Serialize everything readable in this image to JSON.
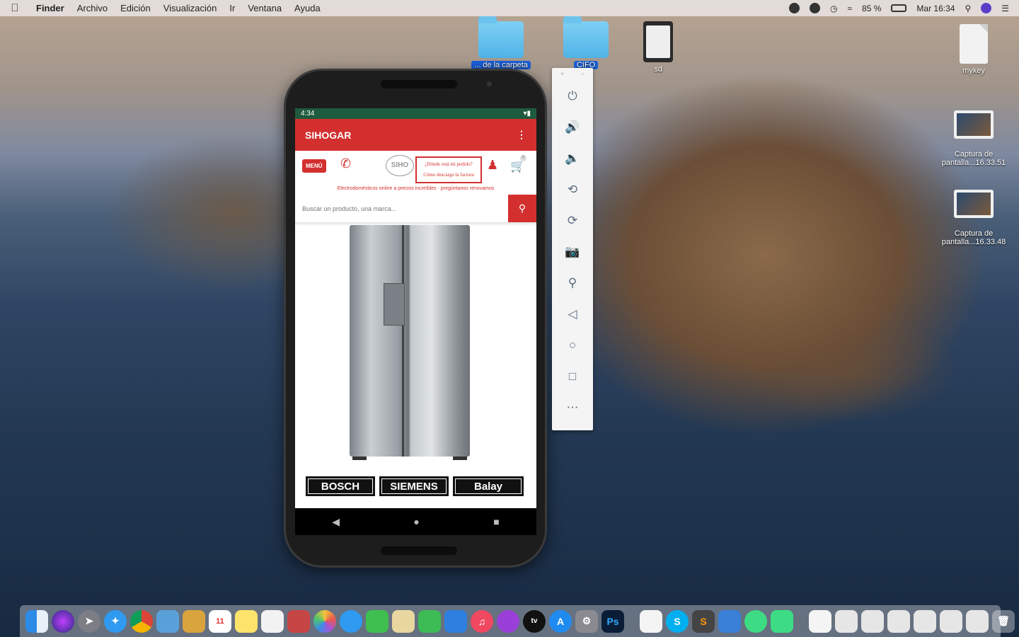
{
  "menubar": {
    "apple_icon": "apple-icon",
    "items": [
      "Finder",
      "Archivo",
      "Edición",
      "Visualización",
      "Ir",
      "Ventana",
      "Ayuda"
    ],
    "battery": "85 %",
    "clock": "Mar 16:34"
  },
  "desktop": {
    "icons": [
      {
        "label": "... de la carpeta",
        "type": "folder",
        "selected": true
      },
      {
        "label": "CIFO",
        "type": "folder",
        "selected": true
      },
      {
        "label": "sd",
        "type": "sdcard",
        "selected": false
      },
      {
        "label": "mykey",
        "type": "document",
        "selected": false
      },
      {
        "label": "Captura de pantalla...16.33.51",
        "type": "screenshot",
        "selected": false
      },
      {
        "label": "Captura de pantalla...16.33.48",
        "type": "screenshot",
        "selected": false
      }
    ]
  },
  "phone": {
    "status_time": "4:34",
    "app_title": "SIHOGAR",
    "menu_label": "MENÚ",
    "logo_text": "SIHO",
    "promo_line1": "¿Dónde está mi pedido?",
    "promo_line2": "Cómo descargo la factura",
    "cart_count": "0",
    "tagline": "Electrodomésticos online a precios increíbles - pregúntanos renovamos",
    "search_placeholder": "Buscar un producto, una marca...",
    "brands": [
      "BOSCH",
      "SIEMENS",
      "Balay"
    ]
  },
  "emulator_toolbar": {
    "buttons": [
      "power-icon",
      "volume-up-icon",
      "volume-down-icon",
      "rotate-left-icon",
      "rotate-right-icon",
      "camera-icon",
      "zoom-icon",
      "back-icon",
      "home-icon",
      "overview-icon",
      "more-icon"
    ]
  },
  "dock": {
    "apps": [
      "Finder",
      "Siri",
      "Launchpad",
      "Safari",
      "Chrome",
      "Preview",
      "Notes",
      "Calendar",
      "Stickies",
      "Reminders",
      "Photo Booth",
      "Photos",
      "Messages",
      "FaceTime",
      "Maps",
      "Numbers",
      "Keynote",
      "Music",
      "Podcasts",
      "TV",
      "App Store",
      "System Preferences",
      "Photoshop",
      "TextEdit",
      "Skype",
      "Sublime Text",
      "Xcode",
      "Android Studio",
      "Android Emulator"
    ],
    "calendar_day": "11"
  },
  "colors": {
    "brand_red": "#d32f2f",
    "status_green": "#1e5a3d",
    "folder_blue": "#4fb3e6"
  }
}
